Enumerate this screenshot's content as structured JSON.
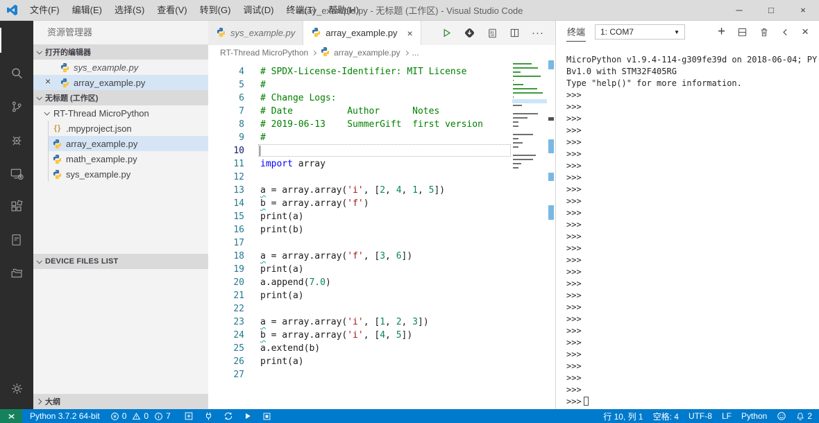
{
  "window": {
    "title": "array_example.py - 无标题 (工作区) - Visual Studio Code",
    "menus": [
      "文件(F)",
      "编辑(E)",
      "选择(S)",
      "查看(V)",
      "转到(G)",
      "调试(D)",
      "终端(T)",
      "帮助(H)"
    ],
    "controls": [
      {
        "name": "minimize",
        "glyph": "─"
      },
      {
        "name": "maximize",
        "glyph": "□"
      },
      {
        "name": "close",
        "glyph": "×"
      }
    ]
  },
  "activity_bar": {
    "items": [
      {
        "name": "explorer",
        "active": true
      },
      {
        "name": "search",
        "active": false
      },
      {
        "name": "source-control",
        "active": false
      },
      {
        "name": "debug",
        "active": false
      },
      {
        "name": "remote-device",
        "active": false
      },
      {
        "name": "extensions",
        "active": false
      },
      {
        "name": "notebook",
        "active": false
      },
      {
        "name": "folders",
        "active": false
      }
    ],
    "bottom": [
      {
        "name": "settings",
        "active": false
      }
    ]
  },
  "sidebar": {
    "title": "资源管理器",
    "open_editors": {
      "header": "打开的编辑器",
      "items": [
        {
          "label": "sys_example.py",
          "icon": "python",
          "preview": true,
          "selected": false,
          "close": ""
        },
        {
          "label": "array_example.py",
          "icon": "python",
          "preview": false,
          "selected": true,
          "close": "×"
        }
      ]
    },
    "workspace": {
      "header": "无标题 (工作区)",
      "folder": "RT-Thread MicroPython",
      "files": [
        {
          "label": ".mpyproject.json",
          "icon": "json",
          "selected": false
        },
        {
          "label": "array_example.py",
          "icon": "python",
          "selected": true
        },
        {
          "label": "math_example.py",
          "icon": "python",
          "selected": false
        },
        {
          "label": "sys_example.py",
          "icon": "python",
          "selected": false
        }
      ]
    },
    "device_files": {
      "header": "DEVICE FILES LIST"
    },
    "outline": {
      "header": "大纲"
    }
  },
  "editor": {
    "tabs": [
      {
        "label": "sys_example.py",
        "icon": "python",
        "active": false,
        "preview": true,
        "close": ""
      },
      {
        "label": "array_example.py",
        "icon": "python",
        "active": true,
        "preview": false,
        "close": "×"
      }
    ],
    "toolbar": [
      "run-file",
      "download",
      "binary-file",
      "split-editor",
      "more-actions"
    ],
    "breadcrumb": [
      {
        "label": "RT-Thread MicroPython",
        "icon": ""
      },
      {
        "label": "array_example.py",
        "icon": "python"
      },
      {
        "label": "...",
        "icon": ""
      }
    ],
    "code_lines": [
      {
        "n": 4,
        "t": [
          [
            "c",
            "# SPDX-License-Identifier: MIT License"
          ]
        ]
      },
      {
        "n": 5,
        "t": [
          [
            "c",
            "#"
          ]
        ]
      },
      {
        "n": 6,
        "t": [
          [
            "c",
            "# Change Logs:"
          ]
        ]
      },
      {
        "n": 7,
        "t": [
          [
            "c",
            "# Date          Author      Notes"
          ]
        ]
      },
      {
        "n": 8,
        "t": [
          [
            "c",
            "# 2019-06-13    SummerGift  first version"
          ]
        ]
      },
      {
        "n": 9,
        "t": [
          [
            "c",
            "#"
          ]
        ]
      },
      {
        "n": 10,
        "t": [],
        "current": true
      },
      {
        "n": 11,
        "t": [
          [
            "k",
            "import"
          ],
          [
            "p",
            " array"
          ]
        ]
      },
      {
        "n": 12,
        "t": []
      },
      {
        "n": 13,
        "t": [
          [
            "v",
            "a"
          ],
          [
            "p",
            " = array.array("
          ],
          [
            "s",
            "'i'"
          ],
          [
            "p",
            ", ["
          ],
          [
            "d",
            "2"
          ],
          [
            "p",
            ", "
          ],
          [
            "d",
            "4"
          ],
          [
            "p",
            ", "
          ],
          [
            "d",
            "1"
          ],
          [
            "p",
            ", "
          ],
          [
            "d",
            "5"
          ],
          [
            "p",
            "])"
          ]
        ]
      },
      {
        "n": 14,
        "t": [
          [
            "v",
            "b"
          ],
          [
            "p",
            " = array.array("
          ],
          [
            "s",
            "'f'"
          ],
          [
            "p",
            ")"
          ]
        ]
      },
      {
        "n": 15,
        "t": [
          [
            "p",
            "print(a)"
          ]
        ]
      },
      {
        "n": 16,
        "t": [
          [
            "p",
            "print(b)"
          ]
        ]
      },
      {
        "n": 17,
        "t": []
      },
      {
        "n": 18,
        "t": [
          [
            "v",
            "a"
          ],
          [
            "p",
            " = array.array("
          ],
          [
            "s",
            "'f'"
          ],
          [
            "p",
            ", ["
          ],
          [
            "d",
            "3"
          ],
          [
            "p",
            ", "
          ],
          [
            "d",
            "6"
          ],
          [
            "p",
            "])"
          ]
        ]
      },
      {
        "n": 19,
        "t": [
          [
            "p",
            "print(a)"
          ]
        ]
      },
      {
        "n": 20,
        "t": [
          [
            "p",
            "a.append("
          ],
          [
            "d",
            "7.0"
          ],
          [
            "p",
            ")"
          ]
        ]
      },
      {
        "n": 21,
        "t": [
          [
            "p",
            "print(a)"
          ]
        ]
      },
      {
        "n": 22,
        "t": []
      },
      {
        "n": 23,
        "t": [
          [
            "v",
            "a"
          ],
          [
            "p",
            " = array.array("
          ],
          [
            "s",
            "'i'"
          ],
          [
            "p",
            ", ["
          ],
          [
            "d",
            "1"
          ],
          [
            "p",
            ", "
          ],
          [
            "d",
            "2"
          ],
          [
            "p",
            ", "
          ],
          [
            "d",
            "3"
          ],
          [
            "p",
            "])"
          ]
        ]
      },
      {
        "n": 24,
        "t": [
          [
            "v",
            "b"
          ],
          [
            "p",
            " = array.array("
          ],
          [
            "s",
            "'i'"
          ],
          [
            "p",
            ", ["
          ],
          [
            "d",
            "4"
          ],
          [
            "p",
            ", "
          ],
          [
            "d",
            "5"
          ],
          [
            "p",
            "])"
          ]
        ]
      },
      {
        "n": 25,
        "t": [
          [
            "p",
            "a.extend(b)"
          ]
        ]
      },
      {
        "n": 26,
        "t": [
          [
            "p",
            "print(a)"
          ]
        ]
      },
      {
        "n": 27,
        "t": []
      }
    ]
  },
  "terminal": {
    "tab_label": "终端",
    "selected_port": "1: COM7",
    "actions": [
      "new-terminal",
      "split-terminal",
      "kill-terminal",
      "chevron-left",
      "close-panel"
    ],
    "banner": [
      "MicroPython v1.9.4-114-g309fe39d on 2018-06-04; PY",
      "Bv1.0 with STM32F405RG",
      "Type \"help()\" for more information."
    ],
    "prompt": ">>>",
    "prompt_repeat": 26,
    "cursor_prompt": ">>>"
  },
  "status_bar": {
    "left": [
      {
        "type": "text",
        "name": "python-interpreter",
        "label": "Python 3.7.2 64-bit"
      },
      {
        "type": "problems",
        "errors": "0",
        "warnings": "0",
        "infos": "7"
      },
      {
        "type": "icon",
        "name": "add-box"
      },
      {
        "type": "icon",
        "name": "plug"
      },
      {
        "type": "icon",
        "name": "sync"
      },
      {
        "type": "icon",
        "name": "run"
      },
      {
        "type": "icon",
        "name": "stop"
      }
    ],
    "right": [
      {
        "type": "text",
        "name": "cursor-position",
        "label": "行 10, 列 1"
      },
      {
        "type": "text",
        "name": "indentation",
        "label": "空格: 4"
      },
      {
        "type": "text",
        "name": "encoding",
        "label": "UTF-8"
      },
      {
        "type": "text",
        "name": "eol",
        "label": "LF"
      },
      {
        "type": "text",
        "name": "language-mode",
        "label": "Python"
      },
      {
        "type": "icon",
        "name": "feedback-smiley"
      },
      {
        "type": "bell",
        "name": "notifications",
        "count": "2"
      }
    ]
  },
  "colors": {
    "statusbar": "#007acc",
    "remote_indicator": "#16825d",
    "activity_bar": "#2c2c2c",
    "selection": "#d6e5f5",
    "comment": "#008000",
    "keyword": "#0000ff",
    "string": "#a31515",
    "number": "#098658",
    "run_button": "#388a34"
  }
}
